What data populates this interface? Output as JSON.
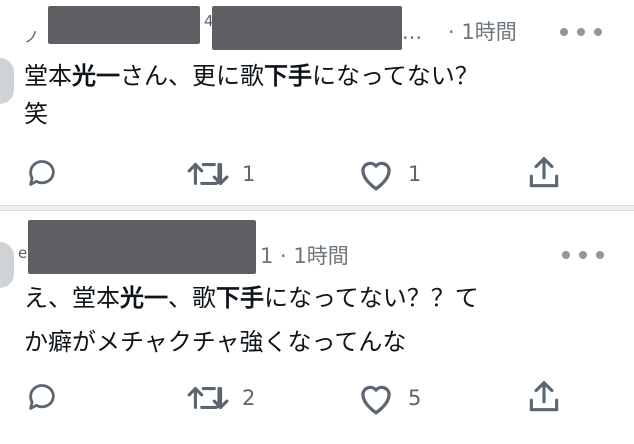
{
  "tweets": [
    {
      "handle_fragment": "ノ",
      "handle_fragment_2": "4",
      "dots": "...",
      "time": "· 1時間",
      "text": {
        "line1_a": "堂本",
        "line1_b": "光一",
        "line1_c": "さん、更に歌",
        "line1_d": "下手",
        "line1_e": "になってない？",
        "line2": "笑"
      },
      "retweets": "1",
      "likes": "1"
    },
    {
      "handle_fragment": "e",
      "time": "1 · 1時間",
      "text": {
        "line1_a": "え、堂本",
        "line1_b": "光一",
        "line1_c": "、歌",
        "line1_d": "下手",
        "line1_e": "になってない？？て",
        "line2": "か癖がメチャクチャ強くなってんな"
      },
      "retweets": "2",
      "likes": "5"
    }
  ],
  "colors": {
    "icon": "#5b6670",
    "meta_text": "#6e767d",
    "redaction": "#5f5f63"
  },
  "icons": [
    "reply-icon",
    "retweet-icon",
    "like-icon",
    "share-icon",
    "more-icon"
  ]
}
